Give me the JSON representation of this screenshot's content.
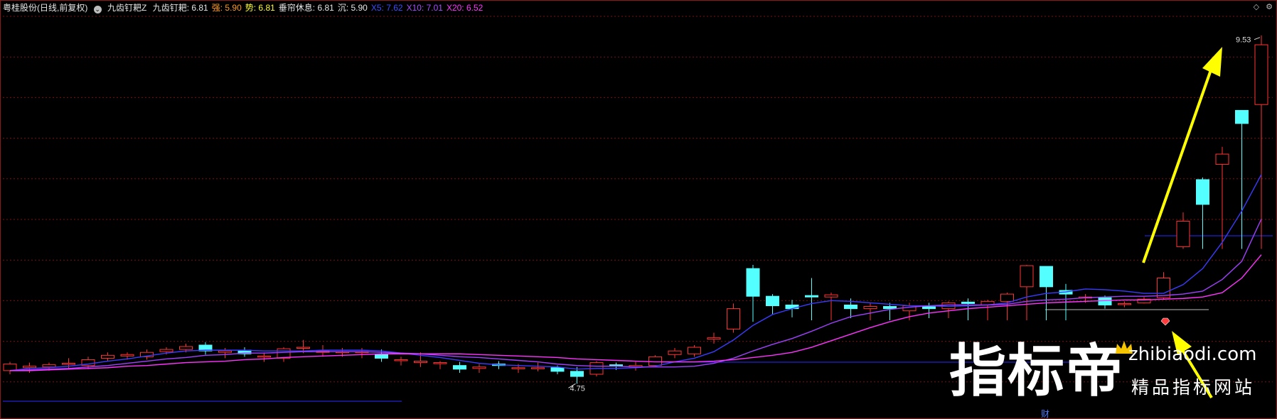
{
  "header": {
    "stock_name": "粤桂股份(日线,前复权)",
    "indicator_name": "九齿钉耙Z",
    "items": [
      {
        "label": "九齿钉耙",
        "value": "6.81",
        "color": "#e6e6e6"
      },
      {
        "label": "强",
        "value": "5.90",
        "color": "#ff9b1a"
      },
      {
        "label": "势",
        "value": "6.81",
        "color": "#ffff2e"
      },
      {
        "label": "垂帘休息",
        "value": "6.81",
        "color": "#e6e6e6"
      },
      {
        "label": "沉",
        "value": "5.90",
        "color": "#e6e6e6"
      },
      {
        "label": "X5",
        "value": "7.62",
        "color": "#3b4dff"
      },
      {
        "label": "X10",
        "value": "7.01",
        "color": "#a64dff"
      },
      {
        "label": "X20",
        "value": "6.52",
        "color": "#ff33ff"
      }
    ]
  },
  "icons": {
    "collapse": "diamond-icon",
    "settings": "gear-icon"
  },
  "chart_data": {
    "type": "candlestick",
    "ylim": [
      4.5,
      9.8
    ],
    "max_label": "9.53",
    "min_label": "4.75",
    "finance_mark": "财",
    "colors": {
      "up": "#ff3232",
      "down": "#54ffff",
      "x5": "#3b3bff",
      "x10": "#a040ff",
      "x20": "#ff33ff",
      "arrow": "#ffff00",
      "baseline": "#2a2aff"
    },
    "candles": [
      [
        4.93,
        5.02,
        5.05,
        4.88
      ],
      [
        4.97,
        4.99,
        5.04,
        4.9
      ],
      [
        4.98,
        5.01,
        5.04,
        4.93
      ],
      [
        5.02,
        5.03,
        5.1,
        4.96
      ],
      [
        5.0,
        5.08,
        5.12,
        4.95
      ],
      [
        5.1,
        5.14,
        5.18,
        5.06
      ],
      [
        5.13,
        5.15,
        5.18,
        5.08
      ],
      [
        5.12,
        5.18,
        5.22,
        5.08
      ],
      [
        5.19,
        5.22,
        5.25,
        5.15
      ],
      [
        5.22,
        5.26,
        5.3,
        5.18
      ],
      [
        5.28,
        5.2,
        5.32,
        5.15
      ],
      [
        5.18,
        5.2,
        5.24,
        5.1
      ],
      [
        5.21,
        5.16,
        5.25,
        5.12
      ],
      [
        5.12,
        5.13,
        5.18,
        5.05
      ],
      [
        5.1,
        5.23,
        5.25,
        5.05
      ],
      [
        5.24,
        5.25,
        5.35,
        5.17
      ],
      [
        5.18,
        5.2,
        5.28,
        5.12
      ],
      [
        5.18,
        5.19,
        5.24,
        5.12
      ],
      [
        5.18,
        5.19,
        5.24,
        5.1
      ],
      [
        5.15,
        5.1,
        5.22,
        5.05
      ],
      [
        5.07,
        5.08,
        5.12,
        5.0
      ],
      [
        5.04,
        5.06,
        5.18,
        4.98
      ],
      [
        5.03,
        5.04,
        5.06,
        4.95
      ],
      [
        5.0,
        4.95,
        5.05,
        4.9
      ],
      [
        4.96,
        4.98,
        5.02,
        4.9
      ],
      [
        5.02,
        5.0,
        5.06,
        4.95
      ],
      [
        4.96,
        4.97,
        5.02,
        4.9
      ],
      [
        4.97,
        4.97,
        5.04,
        4.92
      ],
      [
        4.97,
        4.92,
        5.0,
        4.88
      ],
      [
        4.92,
        4.85,
        4.98,
        4.75
      ],
      [
        4.88,
        5.04,
        5.06,
        4.85
      ],
      [
        5.01,
        4.99,
        5.04,
        4.94
      ],
      [
        4.98,
        5.0,
        5.05,
        4.93
      ],
      [
        5.0,
        5.12,
        5.14,
        4.98
      ],
      [
        5.15,
        5.2,
        5.24,
        5.1
      ],
      [
        5.16,
        5.25,
        5.28,
        5.12
      ],
      [
        5.36,
        5.38,
        5.45,
        5.3
      ],
      [
        5.5,
        5.78,
        5.85,
        5.45
      ],
      [
        6.33,
        5.95,
        6.38,
        5.6
      ],
      [
        5.95,
        5.82,
        5.98,
        5.7
      ],
      [
        5.83,
        5.78,
        5.9,
        5.66
      ],
      [
        5.96,
        5.94,
        6.2,
        5.62
      ],
      [
        5.94,
        5.97,
        6.0,
        5.62
      ],
      [
        5.83,
        5.78,
        5.92,
        5.65
      ],
      [
        5.78,
        5.81,
        5.86,
        5.62
      ],
      [
        5.81,
        5.78,
        5.86,
        5.62
      ],
      [
        5.75,
        5.82,
        5.86,
        5.62
      ],
      [
        5.81,
        5.78,
        5.86,
        5.65
      ],
      [
        5.78,
        5.86,
        5.88,
        5.65
      ],
      [
        5.87,
        5.85,
        5.92,
        5.62
      ],
      [
        5.83,
        5.88,
        5.9,
        5.62
      ],
      [
        5.88,
        5.98,
        6.0,
        5.62
      ],
      [
        6.08,
        6.37,
        6.38,
        5.62
      ],
      [
        6.36,
        6.08,
        6.36,
        5.62
      ],
      [
        6.03,
        5.98,
        6.12,
        5.62
      ],
      [
        5.93,
        5.94,
        5.98,
        5.86
      ],
      [
        5.93,
        5.83,
        5.96,
        5.78
      ],
      [
        5.84,
        5.85,
        5.88,
        5.8
      ],
      [
        5.86,
        5.91,
        5.94,
        5.85
      ],
      [
        5.93,
        6.2,
        6.28,
        5.9
      ],
      [
        6.63,
        6.98,
        7.1,
        6.6
      ],
      [
        7.55,
        7.21,
        7.58,
        6.6
      ],
      [
        7.76,
        7.9,
        8.0,
        6.6
      ],
      [
        8.5,
        8.32,
        8.5,
        6.6
      ],
      [
        8.58,
        9.4,
        9.53,
        6.6
      ]
    ],
    "series": [
      {
        "name": "X5",
        "values": [
          4.93,
          4.96,
          4.97,
          4.99,
          5.02,
          5.06,
          5.09,
          5.13,
          5.17,
          5.2,
          5.21,
          5.21,
          5.21,
          5.2,
          5.2,
          5.2,
          5.21,
          5.21,
          5.21,
          5.2,
          5.17,
          5.14,
          5.11,
          5.07,
          5.03,
          5.01,
          5.0,
          4.99,
          4.98,
          4.95,
          4.96,
          4.96,
          4.97,
          4.99,
          5.05,
          5.1,
          5.19,
          5.35,
          5.55,
          5.7,
          5.78,
          5.85,
          5.89,
          5.88,
          5.86,
          5.84,
          5.82,
          5.82,
          5.81,
          5.82,
          5.83,
          5.86,
          5.94,
          5.99,
          6.01,
          6.05,
          6.04,
          6.02,
          5.99,
          5.99,
          6.11,
          6.33,
          6.69,
          7.12,
          7.62
        ]
      },
      {
        "name": "X10",
        "values": [
          4.93,
          4.94,
          4.95,
          4.96,
          4.98,
          5.0,
          5.03,
          5.06,
          5.09,
          5.11,
          5.14,
          5.15,
          5.17,
          5.17,
          5.18,
          5.19,
          5.19,
          5.19,
          5.19,
          5.18,
          5.17,
          5.16,
          5.14,
          5.12,
          5.11,
          5.09,
          5.07,
          5.05,
          5.02,
          5.0,
          4.99,
          4.99,
          4.98,
          4.98,
          4.98,
          4.99,
          5.03,
          5.1,
          5.2,
          5.29,
          5.37,
          5.47,
          5.58,
          5.67,
          5.72,
          5.77,
          5.8,
          5.82,
          5.83,
          5.83,
          5.83,
          5.84,
          5.88,
          5.9,
          5.91,
          5.93,
          5.94,
          5.95,
          5.95,
          5.96,
          5.98,
          6.02,
          6.18,
          6.43,
          7.01
        ]
      },
      {
        "name": "X20",
        "values": [
          4.93,
          4.93,
          4.94,
          4.95,
          4.96,
          4.97,
          4.99,
          5.0,
          5.02,
          5.04,
          5.05,
          5.06,
          5.08,
          5.09,
          5.11,
          5.12,
          5.13,
          5.14,
          5.15,
          5.16,
          5.16,
          5.16,
          5.16,
          5.16,
          5.15,
          5.14,
          5.13,
          5.12,
          5.11,
          5.09,
          5.08,
          5.07,
          5.06,
          5.05,
          5.05,
          5.05,
          5.06,
          5.08,
          5.11,
          5.14,
          5.18,
          5.25,
          5.34,
          5.43,
          5.52,
          5.6,
          5.67,
          5.72,
          5.75,
          5.78,
          5.8,
          5.82,
          5.84,
          5.86,
          5.87,
          5.88,
          5.89,
          5.9,
          5.9,
          5.91,
          5.92,
          5.94,
          6.0,
          6.2,
          6.52
        ]
      }
    ]
  },
  "watermark": {
    "brand": "指标帝",
    "domain": "zhibiaodi.com",
    "tagline": "精品指标网站"
  }
}
